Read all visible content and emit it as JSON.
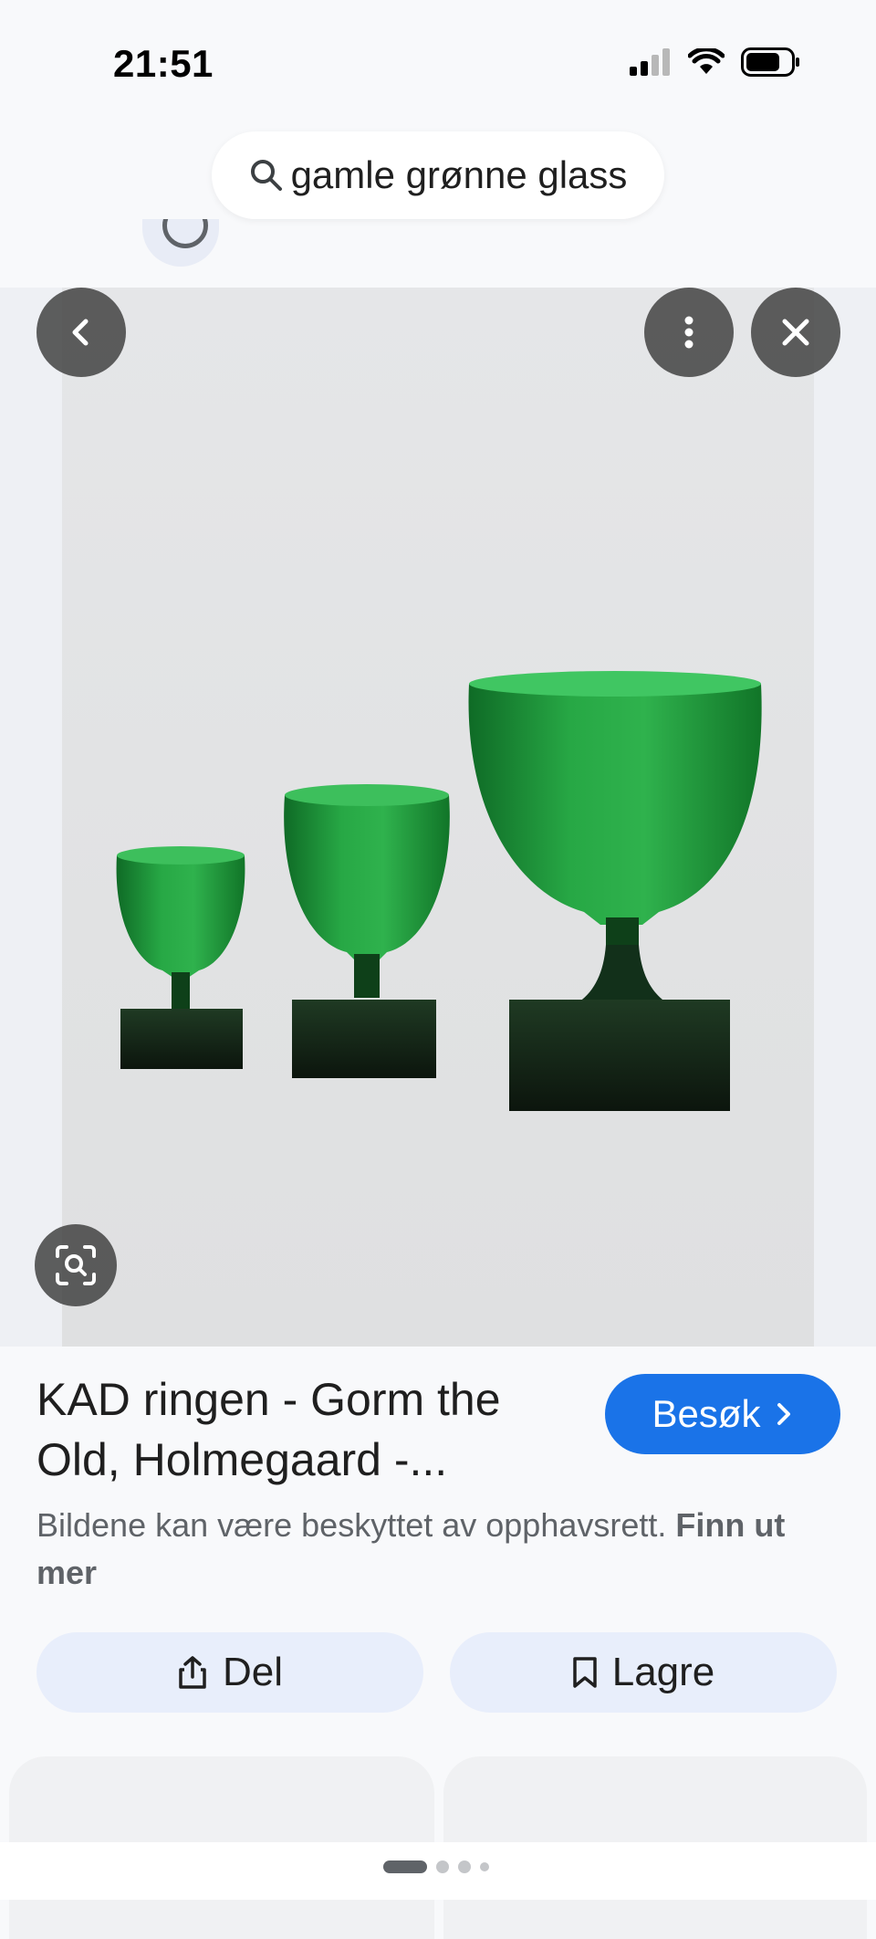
{
  "status_bar": {
    "time": "21:51"
  },
  "search": {
    "query": "gamle grønne glass"
  },
  "result": {
    "title_line1": "KAD ringen - Gorm the",
    "title_line2": "Old, Holmegaard -...",
    "visit_label": "Besøk",
    "copyright_notice": "Bildene kan være beskyttet av opphavsrett.",
    "learn_more": "Finn ut mer"
  },
  "actions": {
    "share_label": "Del",
    "save_label": "Lagre"
  },
  "colors": {
    "accent": "#1a73e8",
    "glass_green": "#1f8f3a",
    "pill_bg": "#e8eefb"
  },
  "icons": [
    "search-icon",
    "back-icon",
    "more-vert-icon",
    "close-icon",
    "lens-icon",
    "share-icon",
    "bookmark-icon",
    "chevron-right-icon",
    "cellular-icon",
    "wifi-icon",
    "battery-icon"
  ]
}
